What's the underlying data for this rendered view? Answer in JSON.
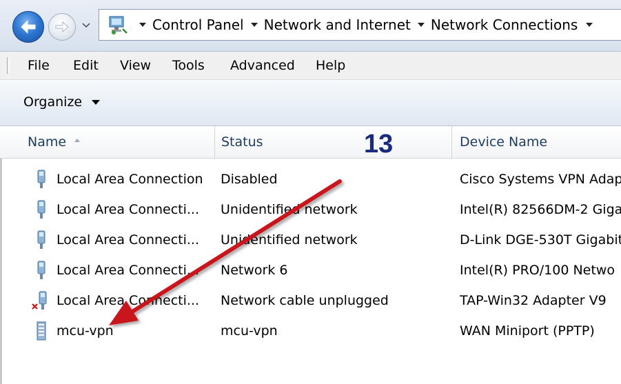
{
  "address_bar": {
    "breadcrumbs": [
      "Control Panel",
      "Network and Internet",
      "Network Connections"
    ]
  },
  "menu": {
    "items": [
      "File",
      "Edit",
      "View",
      "Tools",
      "Advanced",
      "Help"
    ]
  },
  "command_bar": {
    "organize_label": "Organize"
  },
  "columns": {
    "name": "Name",
    "status": "Status",
    "device": "Device Name"
  },
  "annotation": {
    "number": "13"
  },
  "connections": [
    {
      "name": "Local Area Connection",
      "status": "Disabled",
      "device": "Cisco Systems VPN Adap",
      "icon": "network-adapter-icon"
    },
    {
      "name": "Local Area Connecti...",
      "status": "Unidentified network",
      "device": "Intel(R) 82566DM-2 Giga",
      "icon": "network-adapter-icon"
    },
    {
      "name": "Local Area Connecti...",
      "status": "Unidentified network",
      "device": "D-Link DGE-530T Gigabit",
      "icon": "network-adapter-icon"
    },
    {
      "name": "Local Area Connecti...",
      "status": "Network  6",
      "device": "Intel(R) PRO/100 Netwo",
      "icon": "network-adapter-icon"
    },
    {
      "name": "Local Area Connecti...",
      "status": "Network cable unplugged",
      "device": "TAP-Win32 Adapter V9",
      "icon": "network-adapter-unplugged-icon"
    },
    {
      "name": "mcu-vpn",
      "status": "mcu-vpn",
      "device": "WAN Miniport (PPTP)",
      "icon": "vpn-connection-icon"
    }
  ]
}
